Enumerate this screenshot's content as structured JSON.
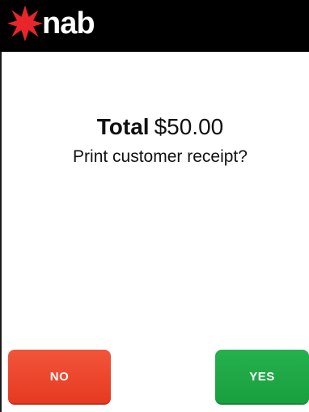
{
  "header": {
    "brand": "nab",
    "logo_icon": "nab-star-icon",
    "logo_color": "#e8252a",
    "background": "#000000"
  },
  "main": {
    "total_label": "Total",
    "total_amount": "$50.00",
    "prompt": "Print customer receipt?"
  },
  "buttons": {
    "no_label": "NO",
    "yes_label": "YES",
    "no_color": "#e9402a",
    "yes_color": "#1fa847"
  }
}
